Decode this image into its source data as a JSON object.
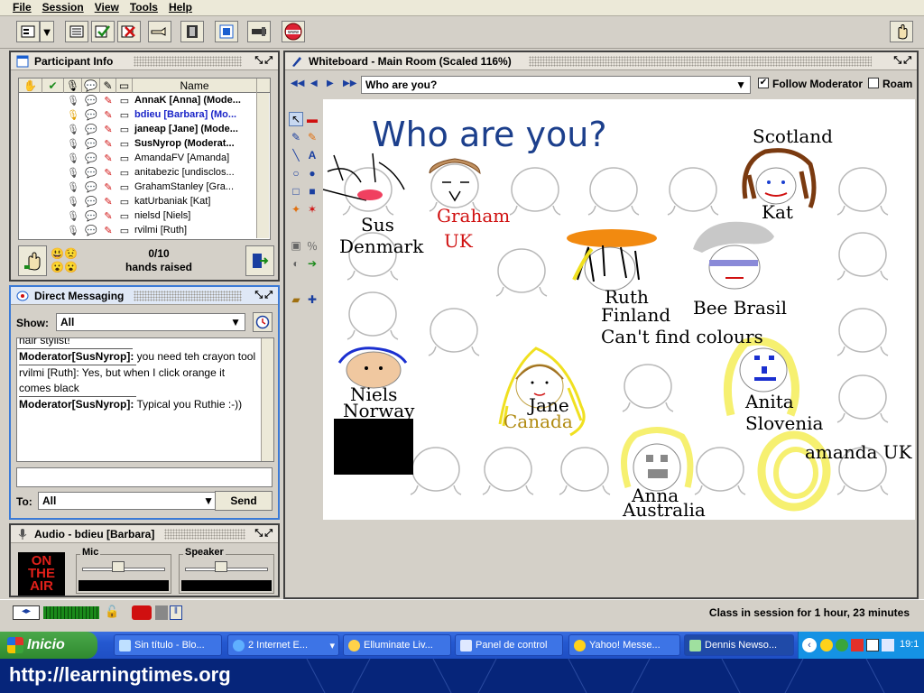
{
  "menu": [
    "File",
    "Session",
    "View",
    "Tools",
    "Help"
  ],
  "participants_panel": {
    "title": "Participant Info",
    "name_header": "Name",
    "rows": [
      {
        "name": "AnnaK [Anna] (Mode...",
        "moderator": true
      },
      {
        "name": "bdieu [Barbara] (Mo...",
        "moderator": true,
        "self": true
      },
      {
        "name": "janeap [Jane] (Mode...",
        "moderator": true
      },
      {
        "name": "SusNyrop (Moderat...",
        "moderator": true
      },
      {
        "name": "AmandaFV [Amanda]",
        "moderator": false
      },
      {
        "name": "anitabezic [undisclos...",
        "moderator": false
      },
      {
        "name": "GrahamStanley [Gra...",
        "moderator": false
      },
      {
        "name": "katUrbaniak [Kat]",
        "moderator": false
      },
      {
        "name": "nielsd [Niels]",
        "moderator": false
      },
      {
        "name": "rvilmi [Ruth]",
        "moderator": false
      }
    ],
    "hands_count": "0/10",
    "hands_label": "hands raised"
  },
  "dm": {
    "title": "Direct Messaging",
    "show_label": "Show:",
    "show_value": "All",
    "log": [
      {
        "plain": "nair stylist!"
      },
      {
        "sender": "Moderator[SusNyrop]:",
        "text": " you need teh crayon tool"
      },
      {
        "plain": "rvilmi [Ruth]: Yes, but when I click orange it comes black"
      },
      {
        "sender": "Moderator[SusNyrop]:",
        "text": " Typical you Ruthie :-))"
      }
    ],
    "to_label": "To:",
    "to_value": "All",
    "send_label": "Send"
  },
  "audio": {
    "title": "Audio - bdieu [Barbara]",
    "onair": [
      "ON",
      "THE",
      "AIR"
    ],
    "mic_label": "Mic",
    "mic_level": 0.42,
    "speaker_label": "Speaker",
    "speaker_level": 0.42
  },
  "whiteboard": {
    "title": "Whiteboard - Main Room (Scaled 116%)",
    "screen_title": "Who are you?",
    "follow_label": "Follow Moderator",
    "follow_checked": true,
    "roam_label": "Roam",
    "roam_checked": false,
    "heading": "Who are you?",
    "labels": {
      "sus": "Sus",
      "denmark": "Denmark",
      "graham": "Graham",
      "uk": "UK",
      "scotland": "Scotland",
      "kat": "Kat",
      "ruth": "Ruth",
      "finland": "Finland",
      "colours": "Can't find colours",
      "bee": "Bee Brasil",
      "niels": "Niels",
      "norway": "Norway",
      "jane": "Jane",
      "canada": "Canada",
      "anita": "Anita",
      "slovenia": "Slovenia",
      "amanda": "amanda UK",
      "anna": "Anna",
      "australia": "Australia"
    }
  },
  "status": {
    "session_text": "Class in session for 1 hour, 23 minutes"
  },
  "taskbar": {
    "start": "Inicio",
    "tasks": [
      "Sin título - Blo...",
      "2 Internet E...",
      "Elluminate Liv...",
      "Panel de control",
      "Yahoo! Messe...",
      "Dennis Newso..."
    ],
    "clock": "19:1"
  },
  "footer": {
    "url": "http://learningtimes.org"
  },
  "colors": {
    "accent": "#3b7ad6",
    "taskbar": "#2458d0",
    "footer": "#06257a",
    "self_name": "#1a24c8",
    "heading": "#1c3f8c"
  }
}
